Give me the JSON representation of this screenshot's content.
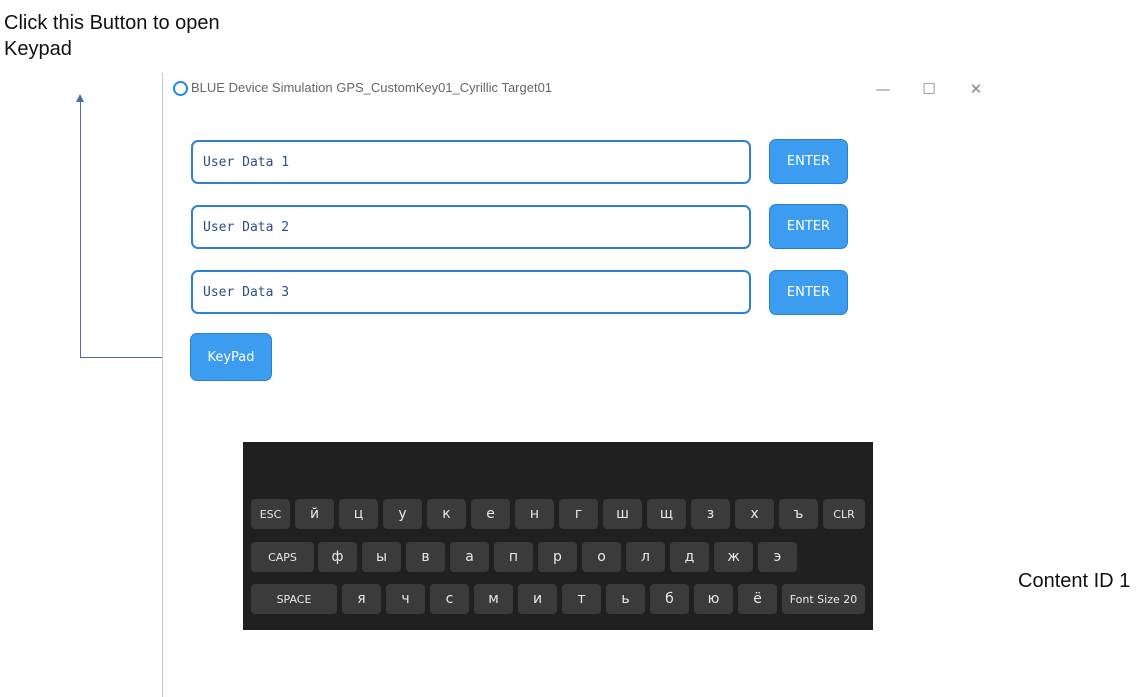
{
  "annotations": {
    "top_left": "Click this Button to open Keypad",
    "right": "Content ID 1"
  },
  "window": {
    "title": "BLUE Device Simulation GPS_CustomKey01_Cyrillic Target01",
    "controls": {
      "minimize": "—",
      "maximize": "☐",
      "close": "✕"
    }
  },
  "inputs": [
    {
      "placeholder": "User Data 1",
      "button": "ENTER"
    },
    {
      "placeholder": "User Data 2",
      "button": "ENTER"
    },
    {
      "placeholder": "User Data 3",
      "button": "ENTER"
    }
  ],
  "keypad_button": "KeyPad",
  "keyboard": {
    "rows": [
      [
        "ESC",
        "й",
        "ц",
        "у",
        "к",
        "е",
        "н",
        "г",
        "ш",
        "щ",
        "з",
        "х",
        "ъ",
        "CLR"
      ],
      [
        "CAPS",
        "ф",
        "ы",
        "в",
        "а",
        "п",
        "р",
        "о",
        "л",
        "д",
        "ж",
        "э"
      ],
      [
        "SPACE",
        "я",
        "ч",
        "с",
        "м",
        "и",
        "т",
        "ь",
        "б",
        "ю",
        "ё",
        "Font Size 20"
      ]
    ]
  },
  "colors": {
    "accent": "#3c9cf0",
    "field_border": "#2f7fd4",
    "keyboard_bg": "#202020",
    "key_bg": "#3b3b3b",
    "annotation_line": "#4a6fb0"
  }
}
